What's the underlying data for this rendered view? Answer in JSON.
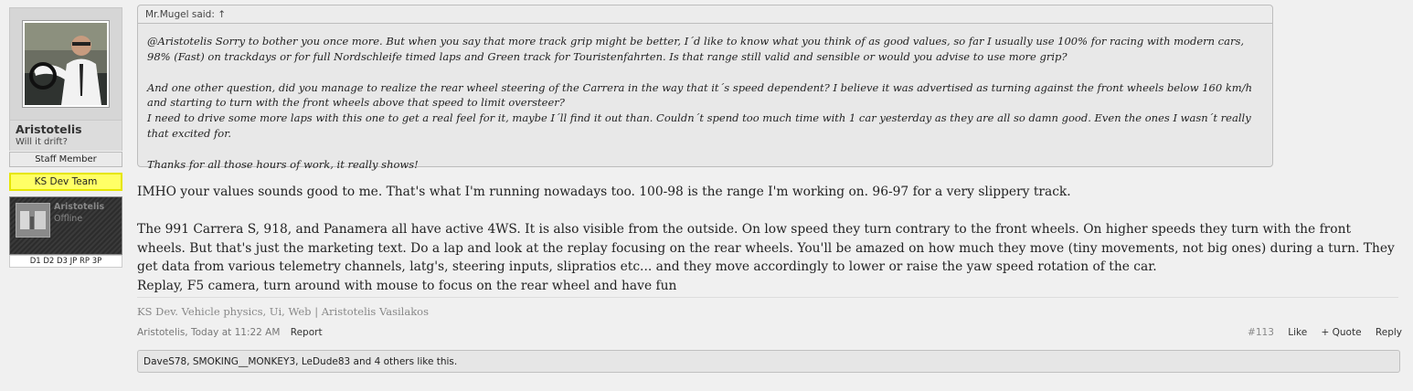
{
  "user": {
    "name": "Aristotelis",
    "title": "Will it drift?",
    "banner_staff": "Staff Member",
    "banner_team": "KS Dev Team",
    "card_name": "Aristotelis",
    "card_status": "Offline",
    "card_tags": "D1 D2 D3 JP RP 3P"
  },
  "quote": {
    "header": "Mr.Mugel said: ↑",
    "paragraphs": [
      "@Aristotelis Sorry to bother you once more. But when you say that more track grip might be better, I´d like to know what you think of as good values, so far I usually use 100% for racing with modern cars, 98% (Fast) on trackdays or for full Nordschleife timed laps and Green track for Touristenfahrten. Is that range still valid and sensible or would you advise to use more grip?",
      "And one other question, did you manage to realize the rear wheel steering of the Carrera in the way that it´s speed dependent? I believe it was advertised as turning against the front wheels below 160 km/h and starting to turn with the front wheels above that speed to limit oversteer?",
      "I need to drive some more laps with this one to get a real feel for it, maybe I´ll find it out than. Couldn´t spend too much time with 1 car yesterday as they are all so damn good. Even the ones I wasn´t really that excited for.",
      "Thanks for all those hours of work, it really shows!"
    ]
  },
  "message": {
    "p1": "IMHO your values sounds good to me. That's what I'm running nowadays too. 100-98 is the range I'm working on. 96-97 for a very slippery track.",
    "p2": "The 991 Carrera S, 918, and Panamera all have active 4WS. It is also visible from the outside. On low speed they turn contrary to the front wheels. On higher speeds they turn with the front wheels. But that's just the marketing text. Do a lap and look at the replay focusing on the rear wheels. You'll be amazed on how much they move (tiny movements, not big ones) during a turn. They get data from various telemetry channels, latg's, steering inputs, slipratios etc... and they move accordingly to lower or raise the yaw speed rotation of the car.",
    "p3": "Replay, F5 camera, turn around with mouse to focus on the rear wheel and have fun"
  },
  "signature": "KS Dev. Vehicle physics, Ui, Web | Aristotelis Vasilakos",
  "meta": {
    "author_time": "Aristotelis, Today at 11:22 AM",
    "report": "Report",
    "post_number": "#113",
    "like": "Like",
    "quote": "+ Quote",
    "reply": "Reply"
  },
  "likes": "DaveS78, SMOKING__MONKEY3, LeDude83 and 4 others like this."
}
